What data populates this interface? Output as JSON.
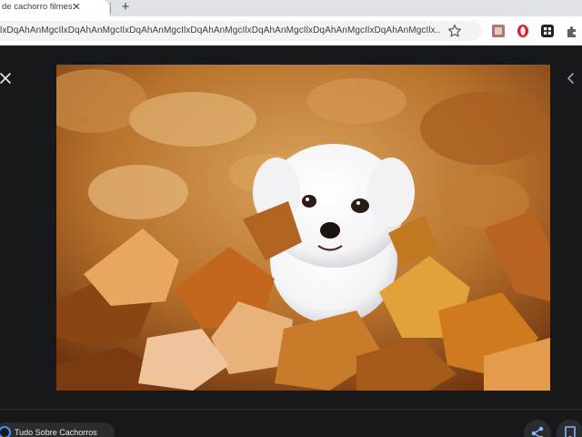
{
  "tab": {
    "title": "de cachorro filmes: c",
    "close_symbol": "✕"
  },
  "new_tab_symbol": "+",
  "address_bar": {
    "url": "lxDqAhAnMgcIlxDqAhAnMgcIlxDqAhAnMgcIlxDqAhAnMgcIlxDqAhAnMgcIlxDqAhAnMgcIlxDqAhAnMgcIlx..."
  },
  "toolbar_icons": [
    "star-icon",
    "extension-icon",
    "opera-icon",
    "grid-extension-icon",
    "puzzle-icon"
  ],
  "viewer": {
    "close_icon": "close-icon",
    "prev_icon": "chevron-left-icon",
    "source_label": "Tudo Sobre Cachorros",
    "colors": {
      "viewer_background": "#17181b",
      "accent": "#4d8cf5"
    }
  }
}
